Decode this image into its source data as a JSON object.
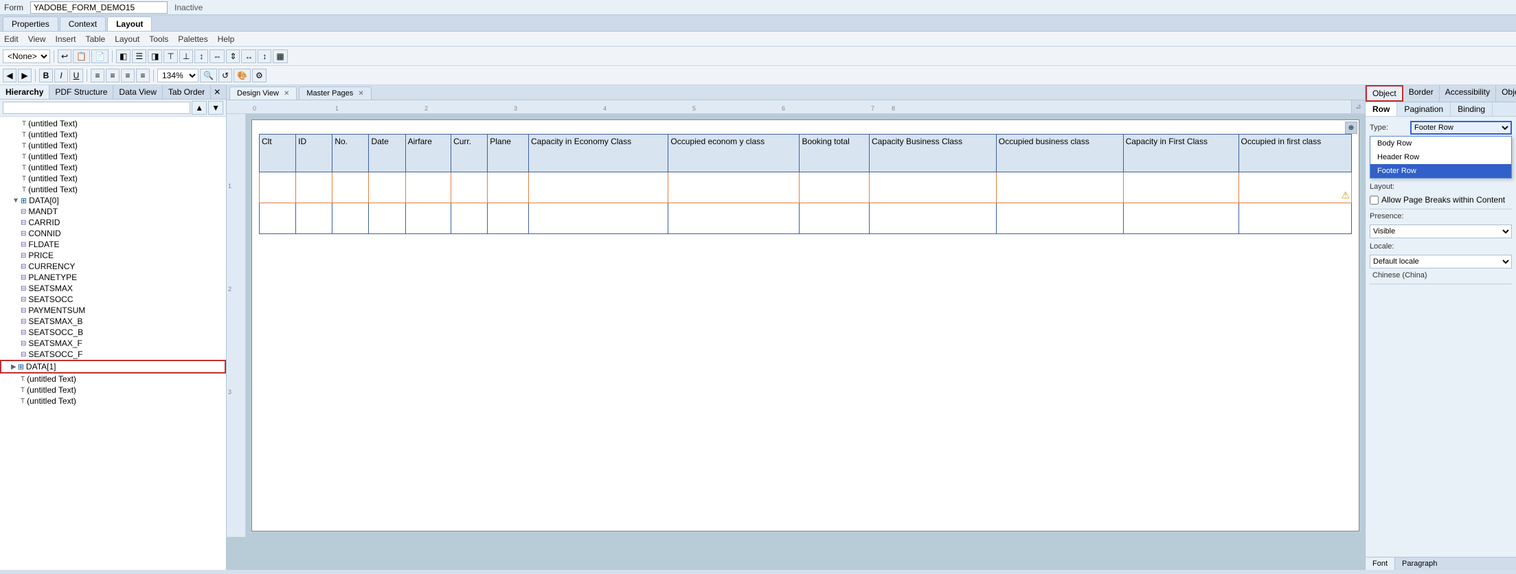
{
  "topbar": {
    "form_label": "Form",
    "form_name": "YADOBE_FORM_DEMO15",
    "status": "Inactive"
  },
  "tabs": {
    "properties": "Properties",
    "context": "Context",
    "layout": "Layout"
  },
  "menu": {
    "edit": "Edit",
    "view": "View",
    "insert": "Insert",
    "table": "Table",
    "layout": "Layout",
    "tools": "Tools",
    "palettes": "Palettes",
    "help": "Help"
  },
  "toolbar": {
    "none_option": "<None>"
  },
  "zoom": {
    "level": "134%"
  },
  "left_panel": {
    "tabs": [
      "Hierarchy",
      "PDF Structure",
      "Data View",
      "Tab Order"
    ],
    "tree_items": [
      {
        "label": "(untitled Text)",
        "indent": 2,
        "icon": "T"
      },
      {
        "label": "(untitled Text)",
        "indent": 2,
        "icon": "T"
      },
      {
        "label": "(untitled Text)",
        "indent": 2,
        "icon": "T"
      },
      {
        "label": "(untitled Text)",
        "indent": 2,
        "icon": "T"
      },
      {
        "label": "(untitled Text)",
        "indent": 2,
        "icon": "T"
      },
      {
        "label": "(untitled Text)",
        "indent": 2,
        "icon": "T"
      },
      {
        "label": "(untitled Text)",
        "indent": 2,
        "icon": "T"
      },
      {
        "label": "DATA[0]",
        "indent": 1,
        "icon": "table",
        "expanded": true
      },
      {
        "label": "MANDT",
        "indent": 2,
        "icon": "field"
      },
      {
        "label": "CARRID",
        "indent": 2,
        "icon": "field"
      },
      {
        "label": "CONNID",
        "indent": 2,
        "icon": "field"
      },
      {
        "label": "FLDATE",
        "indent": 2,
        "icon": "field"
      },
      {
        "label": "PRICE",
        "indent": 2,
        "icon": "field"
      },
      {
        "label": "CURRENCY",
        "indent": 2,
        "icon": "field"
      },
      {
        "label": "PLANETYPE",
        "indent": 2,
        "icon": "field"
      },
      {
        "label": "SEATSMAX",
        "indent": 2,
        "icon": "field"
      },
      {
        "label": "SEATSOCC",
        "indent": 2,
        "icon": "field"
      },
      {
        "label": "PAYMENTSUM",
        "indent": 2,
        "icon": "field"
      },
      {
        "label": "SEATSMAX_B",
        "indent": 2,
        "icon": "field"
      },
      {
        "label": "SEATSOCC_B",
        "indent": 2,
        "icon": "field"
      },
      {
        "label": "SEATSMAX_F",
        "indent": 2,
        "icon": "field"
      },
      {
        "label": "SEATSOCC_F",
        "indent": 2,
        "icon": "field"
      },
      {
        "label": "DATA[1]",
        "indent": 1,
        "icon": "table",
        "selected": true,
        "highlighted": true
      },
      {
        "label": "(untitled Text)",
        "indent": 2,
        "icon": "T"
      },
      {
        "label": "(untitled Text)",
        "indent": 2,
        "icon": "T"
      },
      {
        "label": "(untitled Text)",
        "indent": 2,
        "icon": "T"
      }
    ]
  },
  "design_view": {
    "tabs": [
      "Design View",
      "Master Pages"
    ],
    "table_headers": [
      "Clt",
      "ID",
      "No.",
      "Date",
      "Airfare",
      "Curr.",
      "Plane",
      "Capacity in Economy Class",
      "Occupied econom y class",
      "Booking total",
      "Capacity Business Class",
      "Occupied business class",
      "Capacity in First Class",
      "Occupied in first class"
    ]
  },
  "right_panel": {
    "tabs": [
      "Object",
      "Border",
      "Accessibility",
      "Obje"
    ],
    "sub_tabs": [
      "Row",
      "Pagination",
      "Binding"
    ],
    "type_label": "Type:",
    "type_value": "Footer Row",
    "layout_label": "Layout:",
    "presence_label": "Presence:",
    "presence_value": "Visible",
    "locale_label": "Locale:",
    "locale_default": "Default locale",
    "locale_value": "Chinese (China)",
    "dropdown_options": [
      "Body Row",
      "Header Row",
      "Footer Row"
    ],
    "allow_page_breaks": "Allow Page Breaks within Content",
    "font_tab": "Font",
    "paragraph_tab": "Paragraph"
  }
}
